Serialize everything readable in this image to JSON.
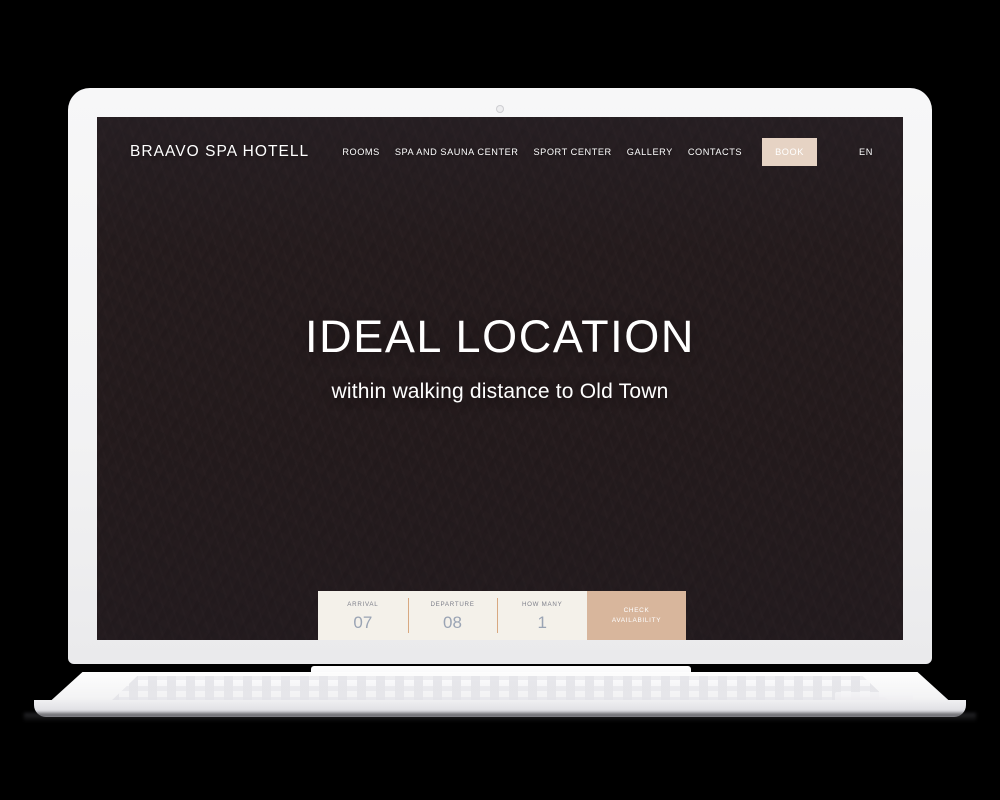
{
  "site": {
    "brand": "BRAAVO SPA HOTELL"
  },
  "nav": {
    "items": [
      {
        "label": "ROOMS"
      },
      {
        "label": "SPA AND SAUNA CENTER"
      },
      {
        "label": "SPORT CENTER"
      },
      {
        "label": "GALLERY"
      },
      {
        "label": "CONTACTS"
      }
    ],
    "book_label": "BOOK",
    "language": "EN",
    "book_bg": "#e6d3c4"
  },
  "hero": {
    "title": "IDEAL LOCATION",
    "subtitle": "within walking distance to Old Town",
    "text_color": "#ffffff"
  },
  "booking": {
    "fields": [
      {
        "label": "ARRIVAL",
        "value": "07"
      },
      {
        "label": "DEPARTURE",
        "value": "08"
      },
      {
        "label": "HOW MANY",
        "value": "1"
      }
    ],
    "submit_line1": "CHECK",
    "submit_line2": "AVAILABILITY",
    "bar_bg": "#f4f1ea",
    "submit_bg": "#d8b69c",
    "divider_color": "#d8a981",
    "value_color": "#9aa4b4",
    "label_color": "#7d7f8a"
  },
  "device": {
    "type": "laptop",
    "body_color": "#f4f4f6"
  }
}
